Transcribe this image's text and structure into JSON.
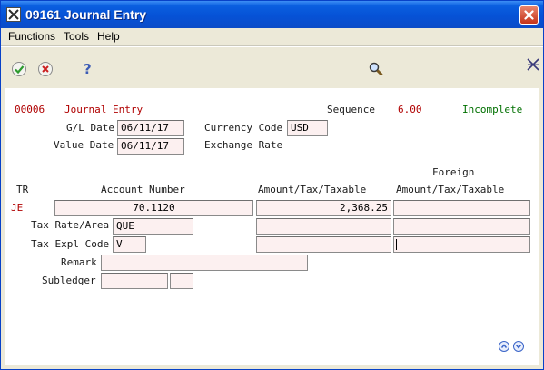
{
  "window": {
    "title": "09161  Journal Entry"
  },
  "menu": {
    "items": [
      "Functions",
      "Tools",
      "Help"
    ]
  },
  "header": {
    "batch_number": "00006",
    "title": "Journal Entry",
    "sequence_label": "Sequence",
    "sequence_value": "6.00",
    "status": "Incomplete",
    "gl_date_label": "G/L Date",
    "gl_date_value": "06/11/17",
    "value_date_label": "Value Date",
    "value_date_value": "06/11/17",
    "currency_code_label": "Currency Code",
    "currency_code_value": "USD",
    "exchange_rate_label": "Exchange Rate"
  },
  "grid": {
    "tr_header": "TR",
    "account_header": "Account Number",
    "amount_header": "Amount/Tax/Taxable",
    "foreign_header_line1": "Foreign",
    "foreign_header_line2": "Amount/Tax/Taxable",
    "tr_value": "JE",
    "account_value": "70.1120",
    "amount_value": "2,368.25",
    "foreign_amount_value": "",
    "tax_amount_value": "",
    "foreign_tax_value": "",
    "taxable_value": "",
    "foreign_taxable_value": ""
  },
  "detail": {
    "tax_rate_label": "Tax Rate/Area",
    "tax_rate_value": "QUE",
    "tax_expl_label": "Tax Expl Code",
    "tax_expl_value": "V",
    "remark_label": "Remark",
    "remark_value": "",
    "subledger_label": "Subledger",
    "subledger_value": "",
    "subledger_type_value": ""
  },
  "colors": {
    "title_bar": "#0652d6",
    "background": "#ece9d8",
    "field_fill": "#fcf0f0",
    "accent_red": "#b00000",
    "status_green": "#007000"
  },
  "icons": [
    "app-icon",
    "close-icon",
    "jde-logo-icon",
    "ok-icon",
    "cancel-icon",
    "help-icon",
    "search-icon",
    "page-up-icon",
    "page-down-icon"
  ]
}
